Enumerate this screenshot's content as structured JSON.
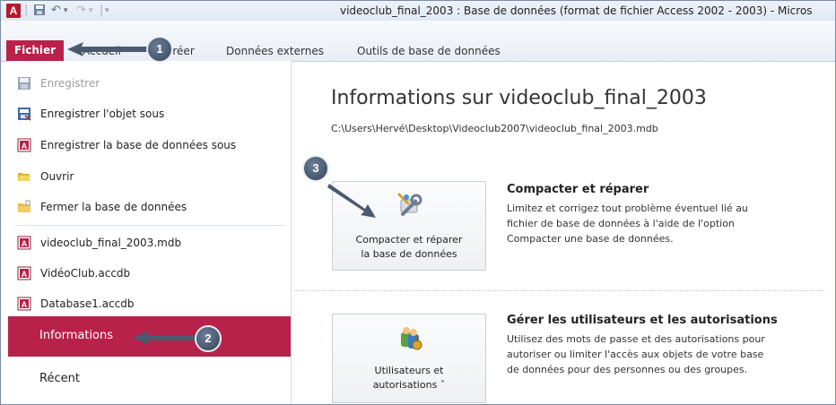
{
  "window": {
    "app_icon_letter": "A",
    "title": "videoclub_final_2003 : Base de données (format de fichier Access 2002 - 2003)  -  Micros"
  },
  "ribbon": {
    "file_tab": "Fichier",
    "tabs": [
      "Accueil",
      "Créer",
      "Données externes",
      "Outils de base de données"
    ]
  },
  "backstage": {
    "menu": [
      {
        "label": "Enregistrer",
        "icon": "save-icon",
        "disabled": true
      },
      {
        "label": "Enregistrer l'objet sous",
        "icon": "save-object-icon"
      },
      {
        "label": "Enregistrer la base de données sous",
        "icon": "save-database-icon"
      },
      {
        "label": "Ouvrir",
        "icon": "folder-open-icon"
      },
      {
        "label": "Fermer la base de données",
        "icon": "folder-close-icon"
      }
    ],
    "recent_files": [
      {
        "label": "videoclub_final_2003.mdb",
        "icon": "database-file-icon"
      },
      {
        "label": "VidéoClub.accdb",
        "icon": "database-file-icon"
      },
      {
        "label": "Database1.accdb",
        "icon": "database-file-icon"
      }
    ],
    "selected": "Informations",
    "recent_label": "Récent"
  },
  "info": {
    "title": "Informations sur videoclub_final_2003",
    "path": "C:\\Users\\Hervé\\Desktop\\Videoclub2007\\videoclub_final_2003.mdb",
    "sections": [
      {
        "button_lines": [
          "Compacter et réparer",
          "la base de données"
        ],
        "title": "Compacter et réparer",
        "desc_lines": [
          "Limitez et corrigez tout problème éventuel lié au",
          "fichier de base de données à l'aide de l'option",
          "Compacter une base de données."
        ]
      },
      {
        "button_lines": [
          "Utilisateurs et",
          "autorisations ˇ"
        ],
        "title": "Gérer les utilisateurs et les autorisations",
        "desc_lines": [
          "Utilisez des mots de passe et des autorisations pour",
          "autoriser ou limiter l'accès aux objets de votre base",
          "de données pour des personnes ou des groupes."
        ]
      }
    ]
  },
  "annotations": {
    "badges": [
      "1",
      "2",
      "3"
    ]
  },
  "colors": {
    "accent": "#b8214a",
    "badge": "#44546a"
  }
}
